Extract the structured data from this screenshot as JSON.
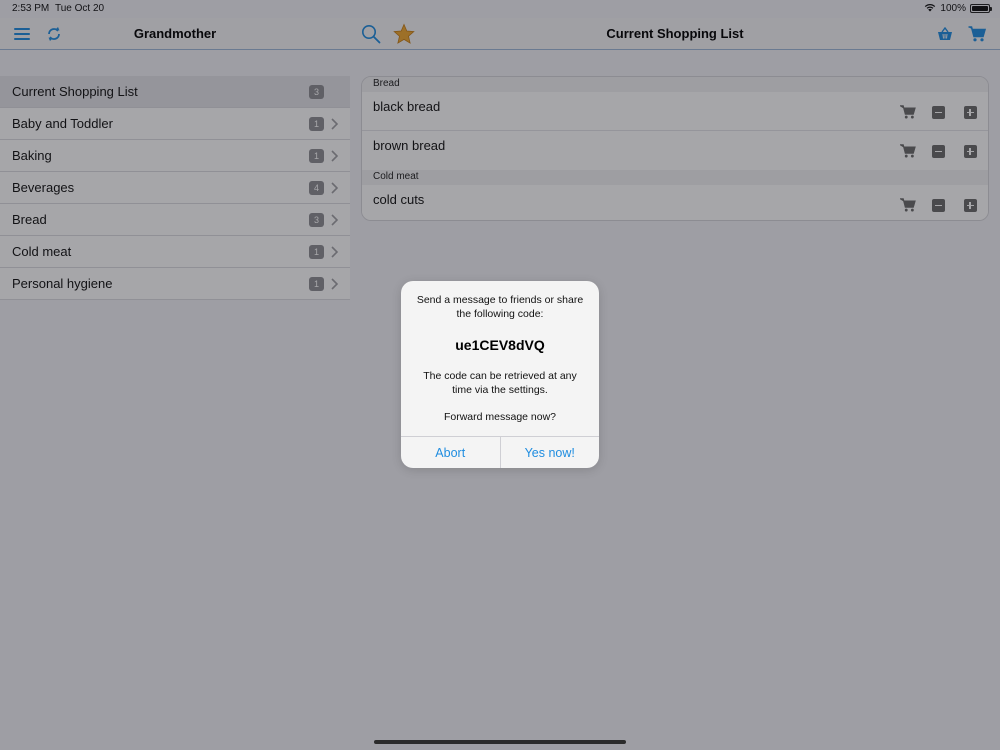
{
  "status": {
    "time": "2:53 PM",
    "date": "Tue Oct 20",
    "battery": "100%"
  },
  "nav": {
    "left_title": "Grandmother",
    "right_title": "Current Shopping List",
    "icons": [
      "menu-icon",
      "sync-icon",
      "search-icon",
      "star-icon",
      "basket-icon",
      "cart-icon"
    ]
  },
  "categories": [
    {
      "label": "Current Shopping List",
      "count": "3"
    },
    {
      "label": "Baby and Toddler",
      "count": "1"
    },
    {
      "label": "Baking",
      "count": "1"
    },
    {
      "label": "Beverages",
      "count": "4"
    },
    {
      "label": "Bread",
      "count": "3"
    },
    {
      "label": "Cold meat",
      "count": "1"
    },
    {
      "label": "Personal hygiene",
      "count": "1"
    }
  ],
  "list": {
    "sections": [
      {
        "header": "Bread",
        "items": [
          "black bread",
          "brown bread"
        ]
      },
      {
        "header": "Cold meat",
        "items": [
          "cold cuts"
        ]
      }
    ]
  },
  "dialog": {
    "message": "Send a message to friends or share the following code:",
    "code": "ue1CEV8dVQ",
    "info": "The code can be retrieved at any time via the settings.",
    "question": "Forward message now?",
    "abort_label": "Abort",
    "confirm_label": "Yes now!"
  },
  "colors": {
    "accent": "#1f8de0",
    "star": "#f0a830",
    "badge": "#8e8e93"
  }
}
